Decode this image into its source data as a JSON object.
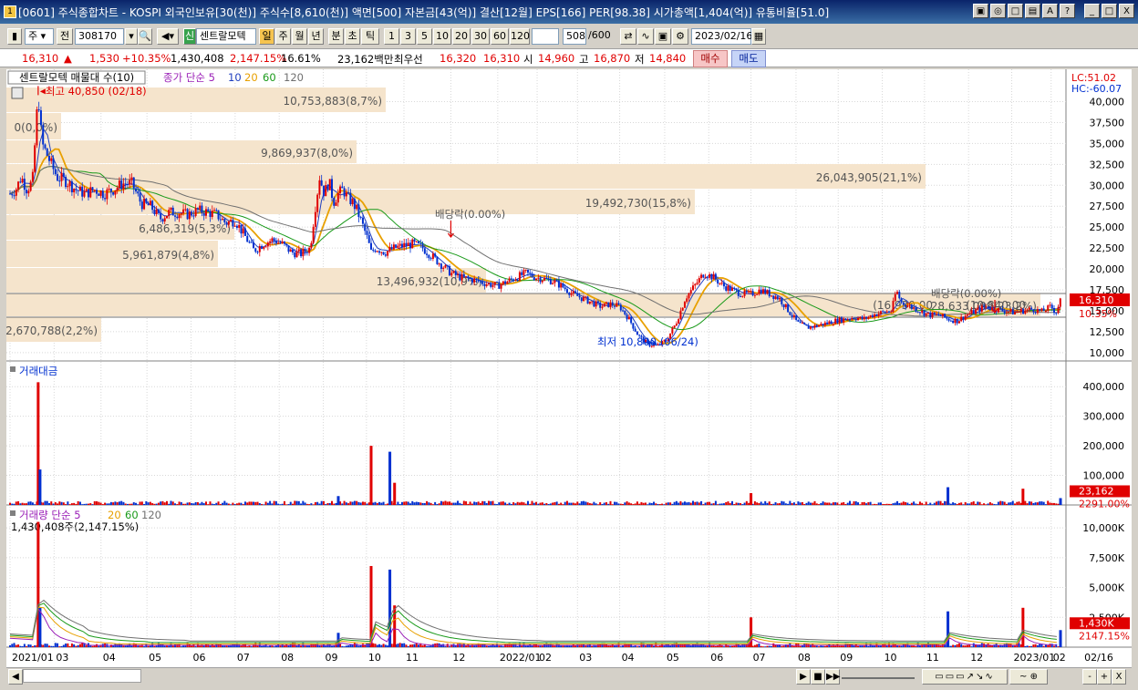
{
  "window": {
    "title": "[0601] 주식종합차트 - KOSPI 외국인보유[30(천)] 주식수[8,610(천)] 액면[500] 자본금[43(억)] 결산[12월] EPS[166] PER[98.38] 시가총액[1,404(억)] 유통비율[51.0]",
    "buttons": [
      "▣",
      "◎",
      "□",
      "▤",
      "A",
      "?",
      "_",
      "□",
      "X"
    ]
  },
  "toolbar": {
    "market_sel": "주",
    "prev_label": "전",
    "code": "308170",
    "stock_name_badge": "신",
    "stock_name": "센트랄모텍",
    "periods": [
      "일",
      "주",
      "월",
      "년",
      "분",
      "초",
      "틱"
    ],
    "active_period": "일",
    "intervals": [
      "1",
      "3",
      "5",
      "10",
      "20",
      "30",
      "60",
      "120"
    ],
    "count": "508",
    "count_total": "/600",
    "date": "2023/02/16"
  },
  "quote": {
    "price": "16,310",
    "arrow": "▲",
    "change": "1,530",
    "change_pct": "+10.35%",
    "volume": "1,430,408",
    "volume_pct": "2,147.15%",
    "turnover": "16.61%",
    "amount": "23,162백만",
    "best_label": "최우선",
    "best_ask": "16,320",
    "best_bid": "16,310",
    "open_label": "시",
    "open": "14,960",
    "high_label": "고",
    "high": "16,870",
    "low_label": "저",
    "low": "14,840",
    "buy_label": "매수",
    "sell_label": "매도"
  },
  "panels": {
    "price_legend_name": "센트랄모텍 매물대 수(10)",
    "price_legend_ma": "종가 단순 5",
    "ma_periods": [
      "10",
      "20",
      "60",
      "120"
    ],
    "ma_colors": [
      "#9a1fb7",
      "#1f3fbf",
      "#e8a000",
      "#1a9a1a",
      "#707070"
    ],
    "amount_title": "거래대금",
    "volume_title": "거래량 단순 5",
    "volume_ma": [
      "20",
      "60",
      "120"
    ],
    "volume_current": "1,430,408주(2,147.15%)",
    "lc": "LC:51.02",
    "hc": "HC:-60.07",
    "price_tag": "16,310",
    "price_pct_tag": "10.35%",
    "amount_tag": "23,162",
    "amount_pct_tag": "2291.00%",
    "volume_tag": "1,430K",
    "volume_pct_tag": "2147.15%",
    "high_note": "최고 40,850 (02/18)",
    "low_note": "최저 10,800 (06/24)",
    "div_note1": "배당락(0.00%)",
    "div_note2": "배당락(0.00%)"
  },
  "chart_data": [
    {
      "type": "candlestick",
      "title": "센트랄모텍 매물대 수(10)",
      "xlabel": "",
      "ylabel": "",
      "ylim": [
        9000,
        43000
      ],
      "yticks": [
        "10,000",
        "12,500",
        "15,000",
        "17,500",
        "20,000",
        "22,500",
        "25,000",
        "27,500",
        "30,000",
        "32,500",
        "35,000",
        "37,500",
        "40,000"
      ],
      "x_ticks": [
        "2021/01",
        "03",
        "04",
        "05",
        "06",
        "07",
        "08",
        "09",
        "10",
        "11",
        "12",
        "2022/01",
        "02",
        "03",
        "04",
        "05",
        "06",
        "07",
        "08",
        "09",
        "10",
        "11",
        "12",
        "2023/01",
        "02"
      ],
      "x_end_label": "02/16",
      "close_path": [
        [
          0,
          29000
        ],
        [
          6,
          29500
        ],
        [
          12,
          31000
        ],
        [
          18,
          29500
        ],
        [
          24,
          30500
        ],
        [
          30,
          41000
        ],
        [
          34,
          35000
        ],
        [
          40,
          33500
        ],
        [
          50,
          31000
        ],
        [
          60,
          30500
        ],
        [
          70,
          29500
        ],
        [
          80,
          29000
        ],
        [
          90,
          29500
        ],
        [
          100,
          29000
        ],
        [
          110,
          29500
        ],
        [
          120,
          30200
        ],
        [
          130,
          30200
        ],
        [
          140,
          27800
        ],
        [
          150,
          27500
        ],
        [
          160,
          26000
        ],
        [
          170,
          26800
        ],
        [
          180,
          26700
        ],
        [
          190,
          26500
        ],
        [
          200,
          27000
        ],
        [
          210,
          26800
        ],
        [
          220,
          26500
        ],
        [
          230,
          25500
        ],
        [
          240,
          25800
        ],
        [
          250,
          24000
        ],
        [
          260,
          22200
        ],
        [
          270,
          23000
        ],
        [
          280,
          23500
        ],
        [
          290,
          23000
        ],
        [
          300,
          22000
        ],
        [
          310,
          21800
        ],
        [
          320,
          22500
        ],
        [
          325,
          27000
        ],
        [
          330,
          31000
        ],
        [
          335,
          29000
        ],
        [
          340,
          30500
        ],
        [
          345,
          28000
        ],
        [
          350,
          29000
        ],
        [
          355,
          29500
        ],
        [
          360,
          28500
        ],
        [
          365,
          28000
        ],
        [
          370,
          27000
        ],
        [
          375,
          25500
        ],
        [
          380,
          24000
        ],
        [
          385,
          22000
        ],
        [
          390,
          22500
        ],
        [
          400,
          22000
        ],
        [
          410,
          22500
        ],
        [
          420,
          22800
        ],
        [
          430,
          23000
        ],
        [
          440,
          22500
        ],
        [
          450,
          21500
        ],
        [
          460,
          20500
        ],
        [
          470,
          19500
        ],
        [
          480,
          19000
        ],
        [
          490,
          18800
        ],
        [
          500,
          18500
        ],
        [
          510,
          18200
        ],
        [
          520,
          18000
        ],
        [
          530,
          18500
        ],
        [
          540,
          19000
        ],
        [
          550,
          19500
        ],
        [
          560,
          19000
        ],
        [
          570,
          18800
        ],
        [
          580,
          18500
        ],
        [
          590,
          17800
        ],
        [
          600,
          17000
        ],
        [
          610,
          16500
        ],
        [
          620,
          16000
        ],
        [
          630,
          15500
        ],
        [
          640,
          15800
        ],
        [
          650,
          15500
        ],
        [
          660,
          14000
        ],
        [
          670,
          12000
        ],
        [
          680,
          11000
        ],
        [
          690,
          10800
        ],
        [
          700,
          11500
        ],
        [
          710,
          13500
        ],
        [
          720,
          16500
        ],
        [
          730,
          18000
        ],
        [
          740,
          19500
        ],
        [
          750,
          19000
        ],
        [
          760,
          18000
        ],
        [
          770,
          17500
        ],
        [
          780,
          17000
        ],
        [
          790,
          17000
        ],
        [
          800,
          17500
        ],
        [
          810,
          17000
        ],
        [
          820,
          16500
        ],
        [
          830,
          15000
        ],
        [
          840,
          13500
        ],
        [
          850,
          13000
        ],
        [
          860,
          13200
        ],
        [
          870,
          13500
        ],
        [
          880,
          13800
        ],
        [
          890,
          14000
        ],
        [
          900,
          14200
        ],
        [
          910,
          14000
        ],
        [
          920,
          14500
        ],
        [
          930,
          14800
        ],
        [
          940,
          15000
        ],
        [
          945,
          17500
        ],
        [
          950,
          16000
        ],
        [
          960,
          15500
        ],
        [
          970,
          15000
        ],
        [
          980,
          14500
        ],
        [
          990,
          14500
        ],
        [
          1000,
          14000
        ],
        [
          1010,
          13800
        ],
        [
          1020,
          14500
        ],
        [
          1030,
          15000
        ],
        [
          1040,
          15500
        ],
        [
          1050,
          15200
        ],
        [
          1060,
          15000
        ],
        [
          1070,
          14800
        ],
        [
          1080,
          15000
        ],
        [
          1090,
          15200
        ],
        [
          1100,
          14900
        ],
        [
          1110,
          15500
        ],
        [
          1115,
          14780
        ],
        [
          1120,
          16310
        ]
      ],
      "volume_profile": [
        {
          "label": "10,753,883(8,7%)"
        },
        {
          "label": "0(0,0%)"
        },
        {
          "label": "9,869,937(8,0%)"
        },
        {
          "label": "26,043,905(21,1%)"
        },
        {
          "label": "19,492,730(15,8%)"
        },
        {
          "label": "6,486,319(5,3%)"
        },
        {
          "label": "5,961,879(4,8%)"
        },
        {
          "label": "13,496,932(10,9%)"
        },
        {
          "label": "28,633,099(23,2%)"
        },
        {
          "label": "2,670,788(2,2%)"
        }
      ],
      "profile_extra_labels": [
        "(16,930,00",
        "(10,840,00"
      ]
    },
    {
      "type": "bar",
      "title": "거래대금",
      "ylim": [
        0,
        450000
      ],
      "yticks": [
        "100,000",
        "200,000",
        "300,000",
        "400,000"
      ],
      "spikes": [
        [
          30,
          415000
        ],
        [
          32,
          120000
        ],
        [
          385,
          200000
        ],
        [
          405,
          180000
        ],
        [
          410,
          75000
        ],
        [
          350,
          30000
        ],
        [
          1080,
          55000
        ],
        [
          1000,
          60000
        ],
        [
          790,
          40000
        ],
        [
          1120,
          23162
        ]
      ]
    },
    {
      "type": "bar",
      "title": "거래량 단순 5",
      "ylim": [
        0,
        11000
      ],
      "yticks": [
        "2,500K",
        "5,000K",
        "7,500K",
        "10,000K"
      ],
      "spikes": [
        [
          30,
          10500
        ],
        [
          32,
          3300
        ],
        [
          385,
          6800
        ],
        [
          405,
          6500
        ],
        [
          410,
          3500
        ],
        [
          350,
          1200
        ],
        [
          1080,
          3300
        ],
        [
          1000,
          3000
        ],
        [
          790,
          2500
        ],
        [
          1120,
          1430
        ]
      ]
    }
  ],
  "bottom": {
    "buttons": [
      "◀",
      "▶",
      "■",
      "▶▶",
      "⋯",
      "-",
      "+",
      "X"
    ]
  }
}
